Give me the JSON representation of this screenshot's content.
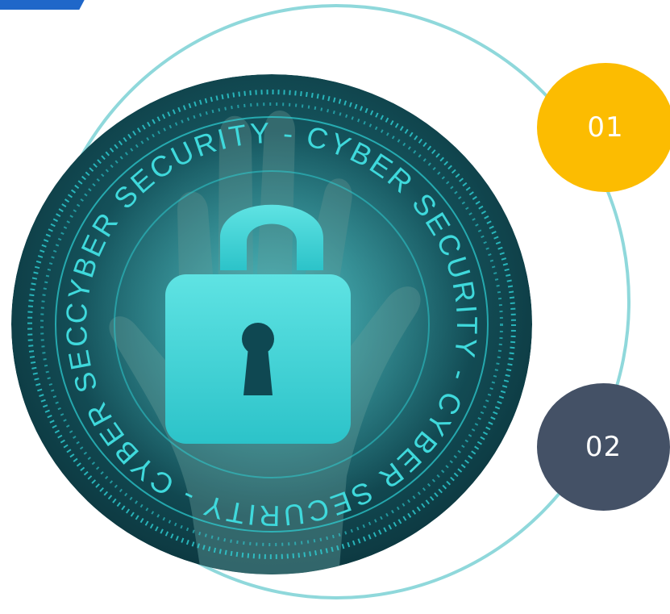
{
  "emblem": {
    "ring_text": "CYBER SECURITY - CYBER SECURITY - CYBER SECURITY - CYBER SECURITY -",
    "icon": "padlock-icon",
    "hand": "raised-hand-image"
  },
  "badges": [
    {
      "label": "01",
      "color": "#fcbc01"
    },
    {
      "label": "02",
      "color": "#445166"
    }
  ],
  "colors": {
    "accent_ring": "#8fd8db",
    "corner_tab": "#1f67c9",
    "emblem_bg": "#0f4852",
    "emblem_glow": "#2ed1d6"
  }
}
